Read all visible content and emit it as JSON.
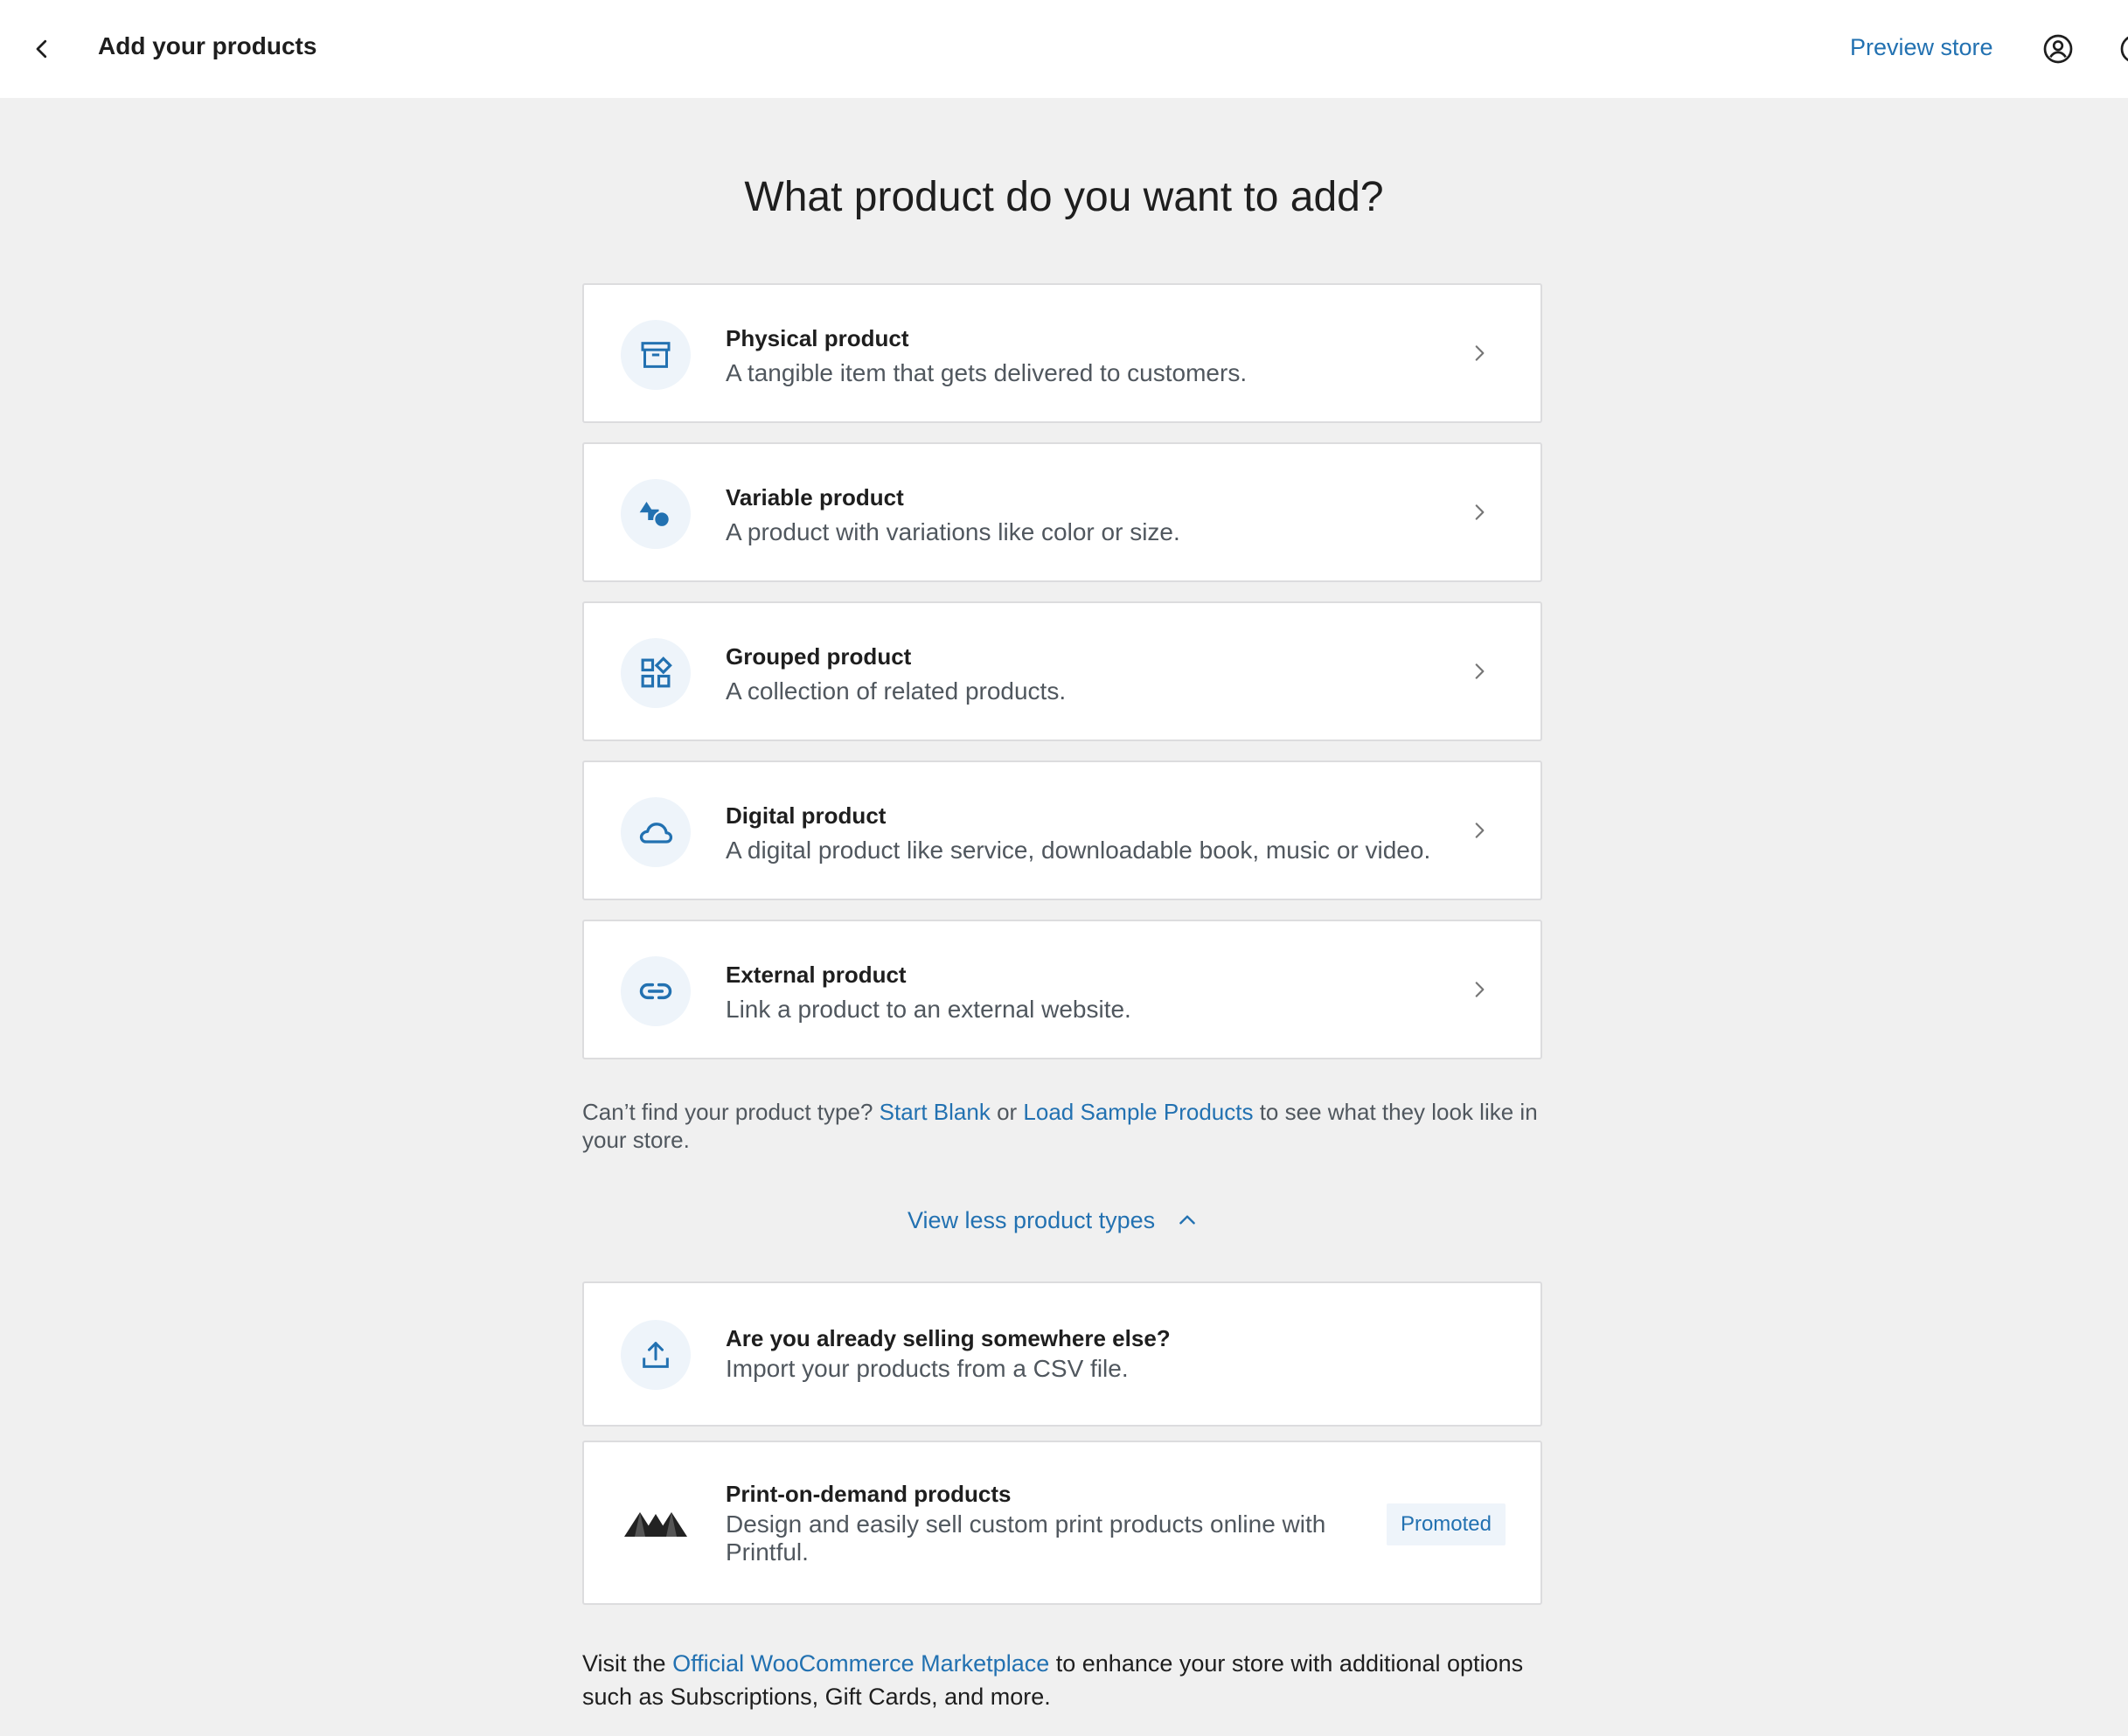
{
  "header": {
    "title": "Add your products",
    "preview_link": "Preview store"
  },
  "main": {
    "heading": "What product do you want to add?",
    "product_types": [
      {
        "title": "Physical product",
        "description": "A tangible item that gets delivered to customers.",
        "icon": "archive-box-icon"
      },
      {
        "title": "Variable product",
        "description": "A product with variations like color or size.",
        "icon": "shapes-icon"
      },
      {
        "title": "Grouped product",
        "description": "A collection of related products.",
        "icon": "grid-icon"
      },
      {
        "title": "Digital product",
        "description": "A digital product like service, downloadable book, music or video.",
        "icon": "cloud-icon"
      },
      {
        "title": "External product",
        "description": "Link a product to an external website.",
        "icon": "link-icon"
      }
    ],
    "cant_find": {
      "prefix": "Can’t find your product type?",
      "start_blank": "Start Blank",
      "or": "or",
      "load_sample": "Load Sample Products",
      "suffix": "to see what they look like in your store."
    },
    "view_less": "View less product types",
    "import_card": {
      "title": "Are you already selling somewhere else?",
      "description": "Import your products from a CSV file.",
      "icon": "upload-icon"
    },
    "printful_card": {
      "title": "Print-on-demand products",
      "description": "Design and easily sell custom print products online with Printful.",
      "badge": "Promoted",
      "icon": "printful-logo"
    },
    "footer": {
      "prefix": "Visit the",
      "link": "Official WooCommerce Marketplace",
      "suffix": "to enhance your store with additional options such as Subscriptions, Gift Cards, and more."
    }
  },
  "colors": {
    "accent": "#2271b1",
    "background": "#f0f0f0",
    "card_border": "#dcdcde",
    "icon_bg": "#eef4fa"
  }
}
